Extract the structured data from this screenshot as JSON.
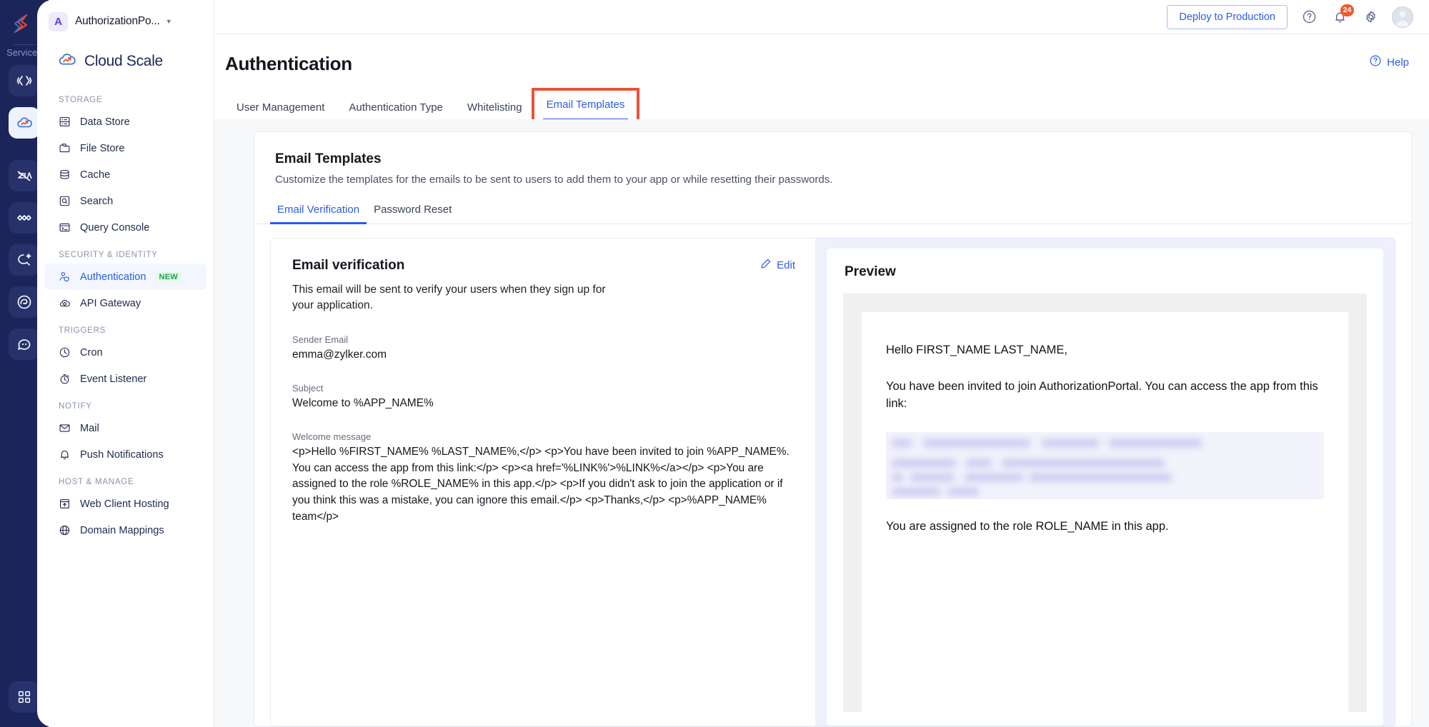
{
  "rail": {
    "logo_icon": "catalyst-logo-icon",
    "services_label": "Services",
    "items": [
      {
        "name": "code-icon",
        "active": false
      },
      {
        "name": "cloud-scale-icon",
        "active": true
      },
      {
        "name": "zia-icon",
        "active": false
      },
      {
        "name": "devops-icon",
        "active": false
      },
      {
        "name": "quickml-icon",
        "active": false
      },
      {
        "name": "galaxy-icon",
        "active": false
      },
      {
        "name": "chat-icon",
        "active": false
      }
    ],
    "bottom_icon": "grid-apps-icon"
  },
  "sidebar": {
    "app_initial": "A",
    "app_name": "AuthorizationPo...",
    "caret_icon": "chevron-down-icon",
    "service_title": "Cloud Scale",
    "service_icon": "cloud-scale-icon",
    "groups": [
      {
        "label": "STORAGE",
        "items": [
          {
            "label": "Data Store",
            "icon": "data-store-icon",
            "active": false,
            "badge": ""
          },
          {
            "label": "File Store",
            "icon": "file-store-icon",
            "active": false,
            "badge": ""
          },
          {
            "label": "Cache",
            "icon": "cache-icon",
            "active": false,
            "badge": ""
          },
          {
            "label": "Search",
            "icon": "search-icon",
            "active": false,
            "badge": ""
          },
          {
            "label": "Query Console",
            "icon": "query-console-icon",
            "active": false,
            "badge": ""
          }
        ]
      },
      {
        "label": "SECURITY & IDENTITY",
        "items": [
          {
            "label": "Authentication",
            "icon": "authentication-icon",
            "active": true,
            "badge": "NEW"
          },
          {
            "label": "API Gateway",
            "icon": "api-gateway-icon",
            "active": false,
            "badge": ""
          }
        ]
      },
      {
        "label": "TRIGGERS",
        "items": [
          {
            "label": "Cron",
            "icon": "cron-clock-icon",
            "active": false,
            "badge": ""
          },
          {
            "label": "Event Listener",
            "icon": "event-listener-icon",
            "active": false,
            "badge": ""
          }
        ]
      },
      {
        "label": "NOTIFY",
        "items": [
          {
            "label": "Mail",
            "icon": "mail-icon",
            "active": false,
            "badge": ""
          },
          {
            "label": "Push Notifications",
            "icon": "bell-icon",
            "active": false,
            "badge": ""
          }
        ]
      },
      {
        "label": "HOST & MANAGE",
        "items": [
          {
            "label": "Web Client Hosting",
            "icon": "web-client-hosting-icon",
            "active": false,
            "badge": ""
          },
          {
            "label": "Domain Mappings",
            "icon": "globe-icon",
            "active": false,
            "badge": ""
          }
        ]
      }
    ]
  },
  "topbar": {
    "deploy_label": "Deploy to Production",
    "help_icon": "question-circle-icon",
    "notifications_icon": "bell-icon",
    "notification_count": "24",
    "settings_icon": "gear-icon",
    "avatar_icon": "user-avatar-icon"
  },
  "page": {
    "title": "Authentication",
    "help_label": "Help",
    "help_icon": "question-circle-icon",
    "tabs": [
      {
        "label": "User Management",
        "active": false,
        "highlighted": false
      },
      {
        "label": "Authentication Type",
        "active": false,
        "highlighted": false
      },
      {
        "label": "Whitelisting",
        "active": false,
        "highlighted": false
      },
      {
        "label": "Email Templates",
        "active": true,
        "highlighted": true
      }
    ]
  },
  "card": {
    "title": "Email Templates",
    "subtitle": "Customize the templates for the emails to be sent to users to add them to your app or while resetting their passwords.",
    "subtabs": [
      {
        "label": "Email Verification",
        "active": true
      },
      {
        "label": "Password Reset",
        "active": false
      }
    ]
  },
  "template": {
    "title": "Email verification",
    "edit_label": "Edit",
    "edit_icon": "pencil-icon",
    "description": "This email will be sent to verify your users when they sign up for your application.",
    "sender_label": "Sender Email",
    "sender_value": "emma@zylker.com",
    "subject_label": "Subject",
    "subject_value": "Welcome to %APP_NAME%",
    "welcome_label": "Welcome message",
    "welcome_value": "<p>Hello %FIRST_NAME% %LAST_NAME%,</p> <p>You have been invited to join %APP_NAME%. You can access the app from this link:</p> <p><a href='%LINK%'>%LINK%</a></p> <p>You are assigned to the role %ROLE_NAME% in this app.</p> <p>If you didn't ask to join the application or if you think this was a mistake, you can ignore this email.</p> <p>Thanks,</p> <p>%APP_NAME% team</p>"
  },
  "preview": {
    "title": "Preview",
    "greeting": "Hello FIRST_NAME LAST_NAME,",
    "invite_line": "You have been invited to join AuthorizationPortal. You can access the app from this link:",
    "link_blurred": true,
    "role_line": "You are assigned to the role ROLE_NAME in this app."
  },
  "colors": {
    "rail_bg": "#1b2559",
    "accent_blue": "#2a5ce8",
    "highlight_red": "#e8533a",
    "badge_orange": "#f0582c",
    "badge_green_text": "#1f9d55",
    "preview_bg": "#eef1fc"
  }
}
